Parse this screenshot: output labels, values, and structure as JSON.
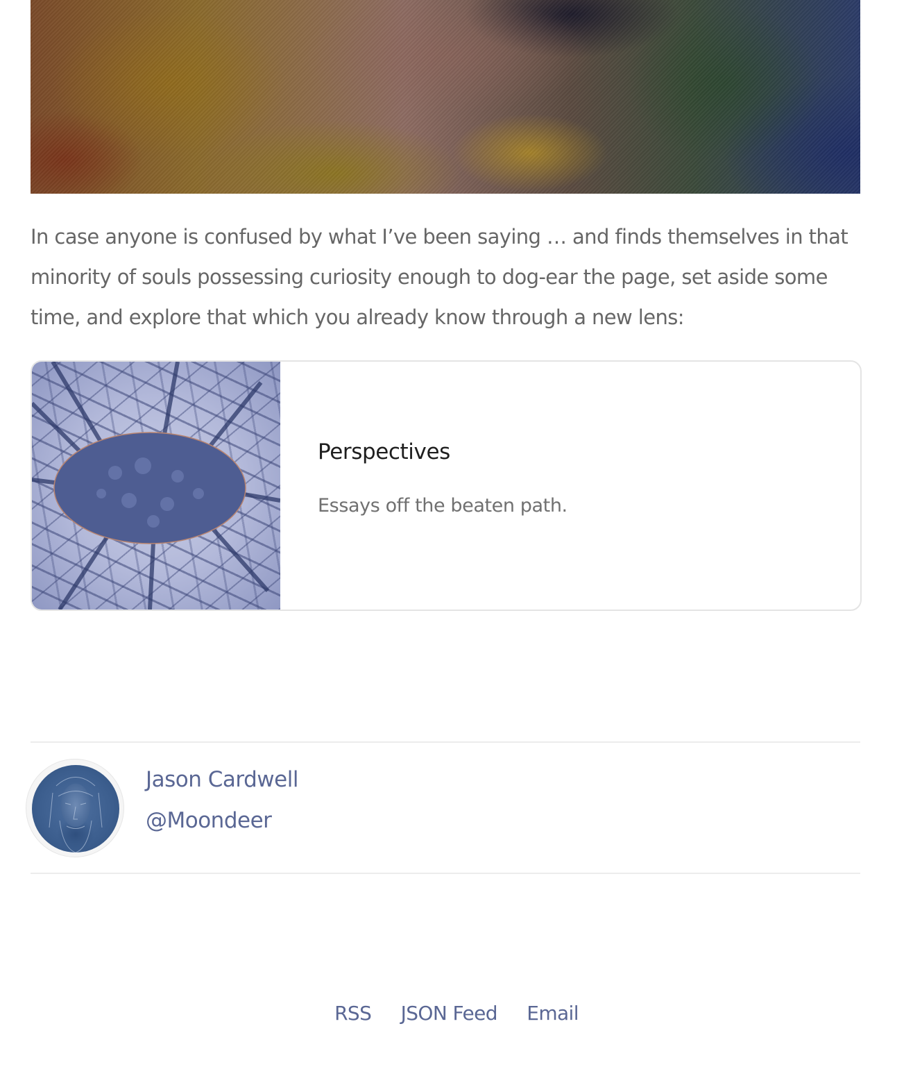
{
  "post": {
    "hero_image_alt": "",
    "intro": "In case anyone is confused by what I’ve been saying … and finds themselves in that minority of souls possessing curiosity enough to dog-ear the page, set aside some time, and explore that which you already know through a new lens:"
  },
  "embed_card": {
    "title": "Perspectives",
    "description": "Essays off the beaten path."
  },
  "author": {
    "name": "Jason Cardwell",
    "handle": "@Moondeer"
  },
  "footer": {
    "links": [
      "RSS",
      "JSON Feed",
      "Email"
    ]
  }
}
